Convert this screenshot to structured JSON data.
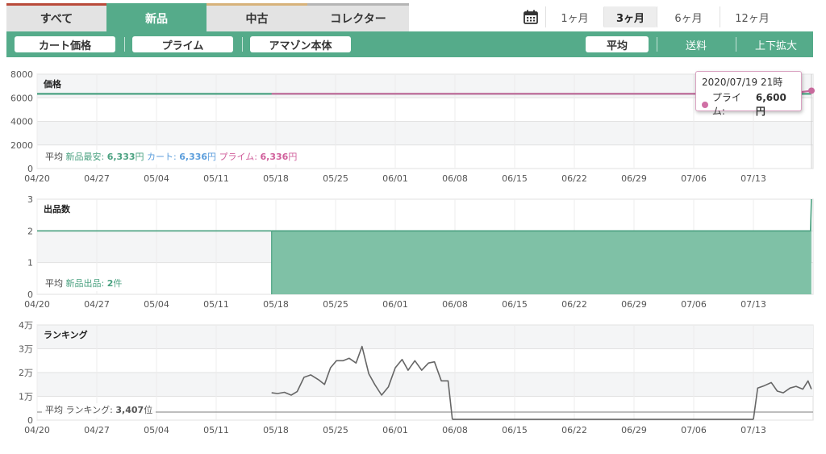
{
  "tabs": {
    "condition": [
      {
        "label": "すべて"
      },
      {
        "label": "新品"
      },
      {
        "label": "中古"
      },
      {
        "label": "コレクター"
      }
    ],
    "ranges": [
      {
        "label": "1ヶ月"
      },
      {
        "label": "3ヶ月"
      },
      {
        "label": "6ヶ月"
      },
      {
        "label": "12ヶ月"
      }
    ]
  },
  "toolbar": {
    "cart": "カート価格",
    "prime": "プライム",
    "amazon": "アマゾン本体",
    "average": "平均",
    "shipping": "送料",
    "zoom": "上下拡大"
  },
  "colors": {
    "accent": "#55ab8a",
    "new_fill": "#7fc1a6",
    "new_line": "#4aa180",
    "prime": "#c86a9d",
    "cart": "#5c9edc",
    "rank_line": "#666666"
  },
  "tooltip": {
    "date": "2020/07/19 21時",
    "label": "プライム:",
    "value": "6,600円"
  },
  "averages": {
    "price": {
      "prefix": "平均",
      "new_label": "新品最安:",
      "new_value": "6,333",
      "new_unit": "円",
      "cart_label": "カート:",
      "cart_value": "6,336",
      "cart_unit": "円",
      "prime_label": "プライム:",
      "prime_value": "6,336",
      "prime_unit": "円"
    },
    "offers": {
      "prefix": "平均",
      "label": "新品出品:",
      "value": "2",
      "unit": "件"
    },
    "rank": {
      "prefix": "平均",
      "label": "ランキング:",
      "value": "3,407",
      "unit": "位"
    }
  },
  "chart_data": [
    {
      "type": "line",
      "title": "価格",
      "x_ticks": [
        "04/20",
        "04/27",
        "05/04",
        "05/11",
        "05/18",
        "05/25",
        "06/01",
        "06/08",
        "06/15",
        "06/22",
        "06/29",
        "07/06",
        "07/13"
      ],
      "y_ticks": [
        "0",
        "2000",
        "4000",
        "6000",
        "8000"
      ],
      "ylim": [
        0,
        8000
      ],
      "series": [
        {
          "color": "#4aa180",
          "x": [
            0,
            27.5,
            90.8
          ],
          "y": [
            6333,
            6333,
            6333
          ]
        },
        {
          "color": "#c86a9d",
          "x": [
            27.5,
            88.0,
            90.8
          ],
          "y": [
            6336,
            6336,
            6600
          ]
        }
      ]
    },
    {
      "type": "area",
      "title": "出品数",
      "x_ticks": [
        "04/20",
        "04/27",
        "05/04",
        "05/11",
        "05/18",
        "05/25",
        "06/01",
        "06/08",
        "06/15",
        "06/22",
        "06/29",
        "07/06",
        "07/13"
      ],
      "y_ticks": [
        "0",
        "1",
        "2",
        "3"
      ],
      "ylim": [
        0,
        3
      ],
      "series": [
        {
          "color": "#4aa180",
          "x": [
            0,
            27.5
          ],
          "y": [
            2,
            2
          ]
        },
        {
          "color": "#4aa180",
          "x": [
            27.5,
            90.7,
            90.8
          ],
          "y": [
            2,
            2,
            3
          ],
          "fill": true
        }
      ]
    },
    {
      "type": "line",
      "title": "ランキング",
      "x_ticks": [
        "04/20",
        "04/27",
        "05/04",
        "05/11",
        "05/18",
        "05/25",
        "06/01",
        "06/08",
        "06/15",
        "06/22",
        "06/29",
        "07/06",
        "07/13"
      ],
      "y_ticks": [
        "0",
        "1万",
        "2万",
        "3万",
        "4万"
      ],
      "ylim": [
        0,
        40000
      ],
      "average": 3407,
      "series": [
        {
          "color": "#666666",
          "x": [
            27.5,
            28.2,
            29.0,
            29.8,
            30.5,
            31.3,
            32.1,
            33.0,
            33.7,
            34.4,
            35.1,
            35.9,
            36.6,
            37.4,
            38.1,
            38.9,
            39.6,
            40.4,
            41.2,
            42.0,
            42.8,
            43.5,
            44.3,
            45.1,
            45.9,
            46.6,
            47.4,
            48.2,
            48.7
          ],
          "y": [
            11500,
            11200,
            11700,
            10500,
            12000,
            18000,
            19000,
            17000,
            15000,
            22000,
            25000,
            25000,
            26000,
            24000,
            31000,
            19500,
            15000,
            10500,
            14000,
            22000,
            25500,
            21000,
            25000,
            21000,
            24000,
            24500,
            16500,
            16500,
            300
          ]
        },
        {
          "color": "#666666",
          "x": [
            48.7,
            84.0
          ],
          "y": [
            300,
            300
          ]
        },
        {
          "color": "#666666",
          "x": [
            84.0,
            84.5,
            85.3,
            86.1,
            86.8,
            87.5,
            88.3,
            89.0,
            89.8,
            90.4,
            90.8
          ],
          "y": [
            300,
            13500,
            14500,
            15800,
            12200,
            11500,
            13500,
            14200,
            13000,
            16500,
            13000
          ]
        }
      ]
    }
  ]
}
